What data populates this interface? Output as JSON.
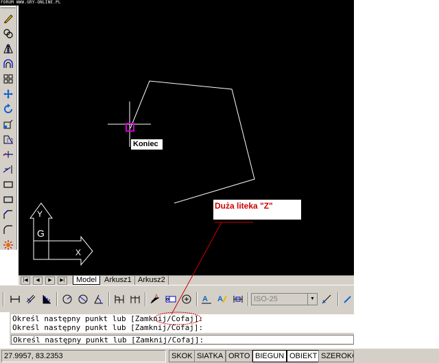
{
  "watermark": "FORUM WWW.GRY-ONLINE.PL",
  "drawing": {
    "snap_tooltip": "Koniec",
    "annotation": "Duża liteka \"Z\"",
    "ucs_label": "G",
    "ucs_x": "X",
    "ucs_y": "Y",
    "colors": {
      "background": "#000000",
      "polyline": "#ffffff",
      "snap_marker": "#cc00cc",
      "annotation": "#cc0000"
    }
  },
  "tabs": {
    "nav": [
      "|◀",
      "◀",
      "▶",
      "▶|"
    ],
    "items": [
      "Model",
      "Arkusz1",
      "Arkusz2"
    ]
  },
  "dimstyle": {
    "value": "ISO-25"
  },
  "command": {
    "lines": [
      "Określ następny punkt lub [Zamknij/Cofaj]:",
      "Określ następny punkt lub [Zamknij/Cofaj]:",
      "Określ następny punkt lub [Zamknij/Cofaj]:"
    ]
  },
  "status": {
    "coords": "27.9957, 83.2353",
    "buttons": [
      {
        "label": "SKOK",
        "on": false
      },
      {
        "label": "SIATKA",
        "on": false
      },
      {
        "label": "ORTO",
        "on": false
      },
      {
        "label": "BIEGUN",
        "on": true
      },
      {
        "label": "OBIEKT",
        "on": true
      },
      {
        "label": "SZEROKO",
        "on": false
      }
    ]
  },
  "icons": {
    "left_toolbar": [
      "erase-icon",
      "copy-icon",
      "mirror-icon",
      "offset-icon",
      "array-icon",
      "move-icon",
      "rotate-icon",
      "scale-icon",
      "stretch-icon",
      "trim-icon",
      "extend-icon",
      "break-icon",
      "break-at-point-icon",
      "chamfer-icon",
      "fillet-icon",
      "explode-icon"
    ]
  }
}
